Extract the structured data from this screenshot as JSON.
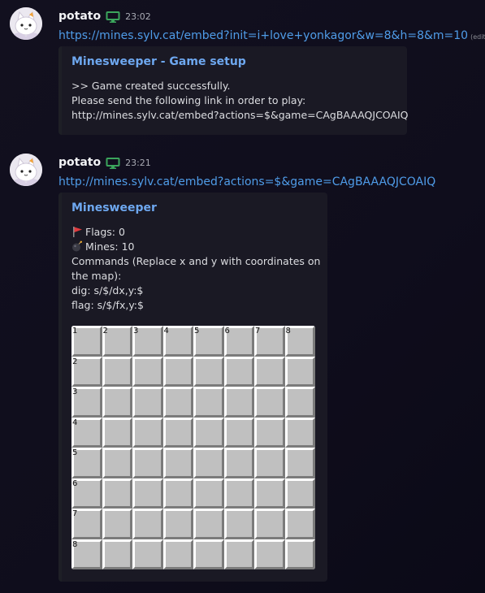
{
  "messages": [
    {
      "username": "potato",
      "platform_icon": "desktop-icon",
      "timestamp": "23:02",
      "link": "https://mines.sylv.cat/embed?init=i+love+yonkagor&w=8&h=8&m=10",
      "edited_label": "(edited)",
      "embed": {
        "title": "Minesweeper - Game setup",
        "lines": [
          ">> Game created successfully.",
          "Please send the following link in order to play:",
          "http://mines.sylv.cat/embed?actions=$&game=CAgBAAAQJCOAIQ"
        ]
      }
    },
    {
      "username": "potato",
      "platform_icon": "desktop-icon",
      "timestamp": "23:21",
      "link": "http://mines.sylv.cat/embed?actions=$&game=CAgBAAAQJCOAIQ",
      "embed": {
        "title": "Minesweeper",
        "flags_line": "Flags: 0",
        "flags_icon": "red-flag-icon",
        "mines_line": "Mines: 10",
        "mines_icon": "bomb-icon",
        "commands_line_1": "Commands (Replace x and y with coordinates on",
        "commands_line_2": "the map):",
        "dig_line": "dig: s/$/dx,y:$",
        "flag_line": "flag: s/$/fx,y:$",
        "board": {
          "columns": [
            "1",
            "2",
            "3",
            "4",
            "5",
            "6",
            "7",
            "8"
          ],
          "rows": [
            "1",
            "2",
            "3",
            "4",
            "5",
            "6",
            "7",
            "8"
          ],
          "cell_state": "unrevealed",
          "cell_color": "#c0c0c0"
        }
      }
    }
  ],
  "colors": {
    "link": "#4f9ce8",
    "embed_title": "#6ea8f0",
    "platform_icon": "#3ba55c"
  }
}
